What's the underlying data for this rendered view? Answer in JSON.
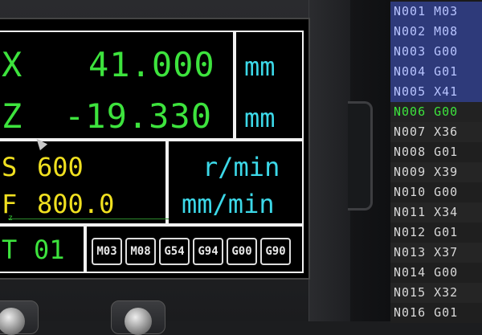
{
  "axes": {
    "x": {
      "label": "X",
      "value": "41.000",
      "unit": "mm"
    },
    "z": {
      "label": "Z",
      "value": "-19.330",
      "unit": "mm"
    }
  },
  "spindle": {
    "label": "S",
    "value": "600",
    "unit": "r/min"
  },
  "feed": {
    "label": "F",
    "value": "800.0",
    "unit": "mm/min"
  },
  "tool": {
    "label": "T",
    "value": "01"
  },
  "modal_codes": [
    "M03",
    "M08",
    "G54",
    "G94",
    "G00",
    "G90"
  ],
  "axis_hint": "z",
  "program_lines": [
    {
      "n": "N001",
      "code": "M03"
    },
    {
      "n": "N002",
      "code": "M08"
    },
    {
      "n": "N003",
      "code": "G00"
    },
    {
      "n": "N004",
      "code": "G01"
    },
    {
      "n": "N005",
      "code": "X41"
    },
    {
      "n": "N006",
      "code": "G00"
    },
    {
      "n": "N007",
      "code": "X36"
    },
    {
      "n": "N008",
      "code": "G01"
    },
    {
      "n": "N009",
      "code": "X39"
    },
    {
      "n": "N010",
      "code": "G00"
    },
    {
      "n": "N011",
      "code": "X34"
    },
    {
      "n": "N012",
      "code": "G01"
    },
    {
      "n": "N013",
      "code": "X37"
    },
    {
      "n": "N014",
      "code": "G00"
    },
    {
      "n": "N015",
      "code": "X32"
    },
    {
      "n": "N016",
      "code": "G01"
    }
  ],
  "active_line": "N006",
  "colors": {
    "value": "#3de33d",
    "unit": "#3cd8e8",
    "feed": "#f0e020",
    "listing_highlight": "#2e3a7a",
    "listing_active": "#3de33d"
  }
}
